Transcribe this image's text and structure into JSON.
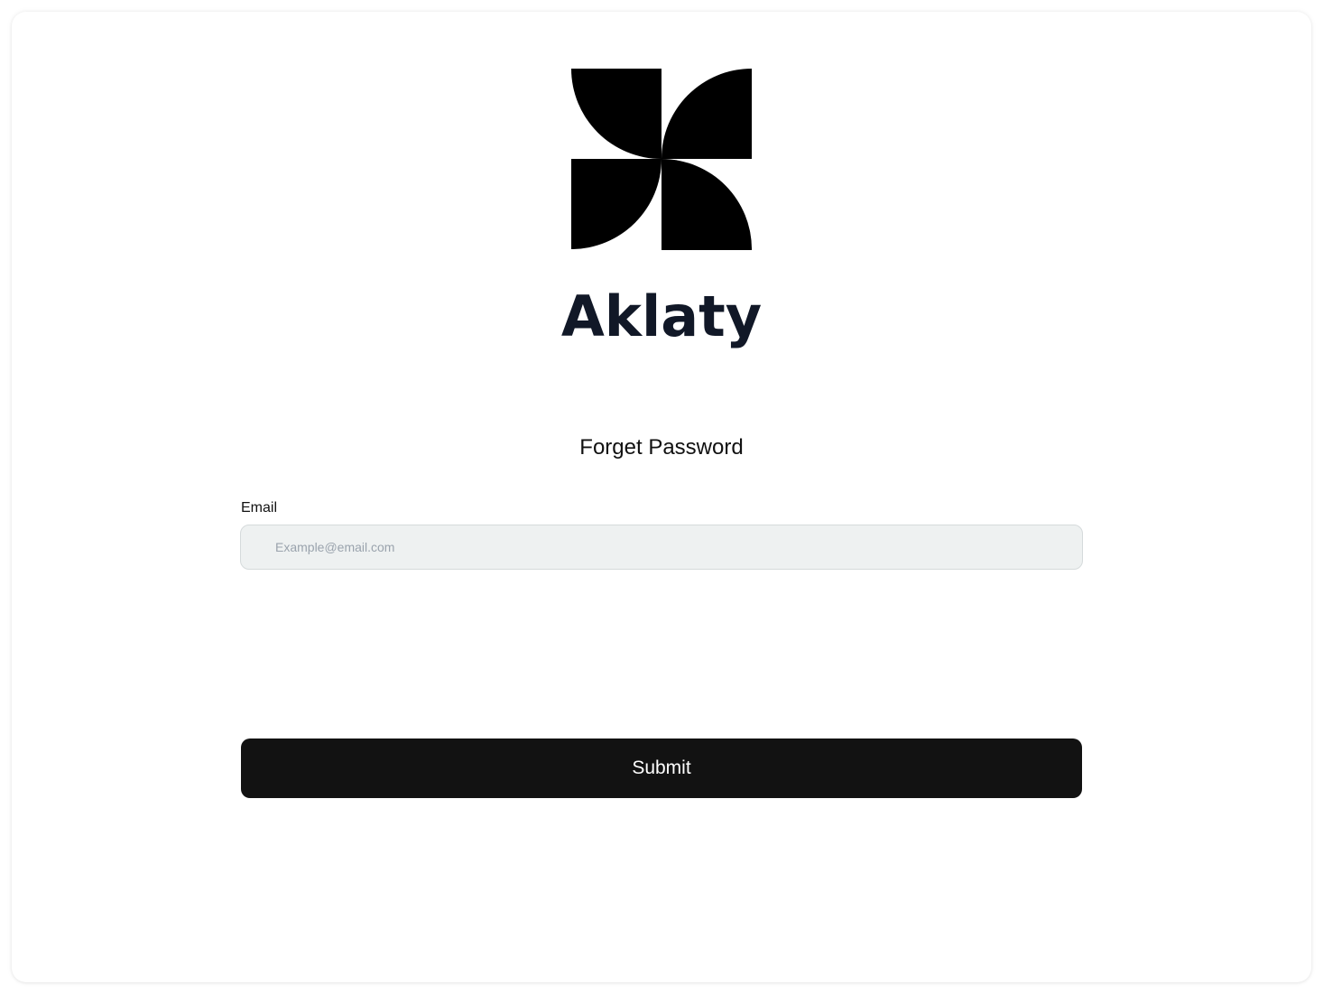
{
  "brand": {
    "name": "Aklaty",
    "logo_icon": "pinwheel-logo-icon"
  },
  "form": {
    "title": "Forget Password",
    "email_label": "Email",
    "email_placeholder": "Example@email.com",
    "email_value": "",
    "submit_label": "Submit"
  },
  "colors": {
    "primary": "#121212",
    "input_bg": "#eef1f1",
    "text_dark": "#111827"
  }
}
